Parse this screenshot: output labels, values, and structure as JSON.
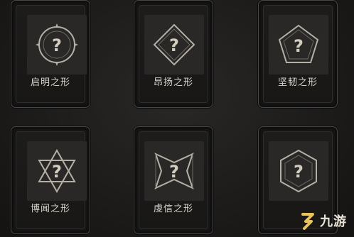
{
  "cards": [
    {
      "label": "启明之形",
      "shape": "circle-icon"
    },
    {
      "label": "昂扬之形",
      "shape": "diamond-icon"
    },
    {
      "label": "坚韧之形",
      "shape": "pentagon-icon"
    },
    {
      "label": "博闻之形",
      "shape": "hexagram-icon"
    },
    {
      "label": "虔信之形",
      "shape": "bowtie-icon"
    },
    {
      "label": "",
      "shape": "hexagon-icon"
    }
  ],
  "emblem_mark": "?",
  "watermark": {
    "text": "九游",
    "logo": "9-logo-icon"
  },
  "colors": {
    "emblem_stroke": "#b5b0a6",
    "emblem_inner": "#c9c3b6",
    "watermark_accent": "#e9c25a"
  }
}
